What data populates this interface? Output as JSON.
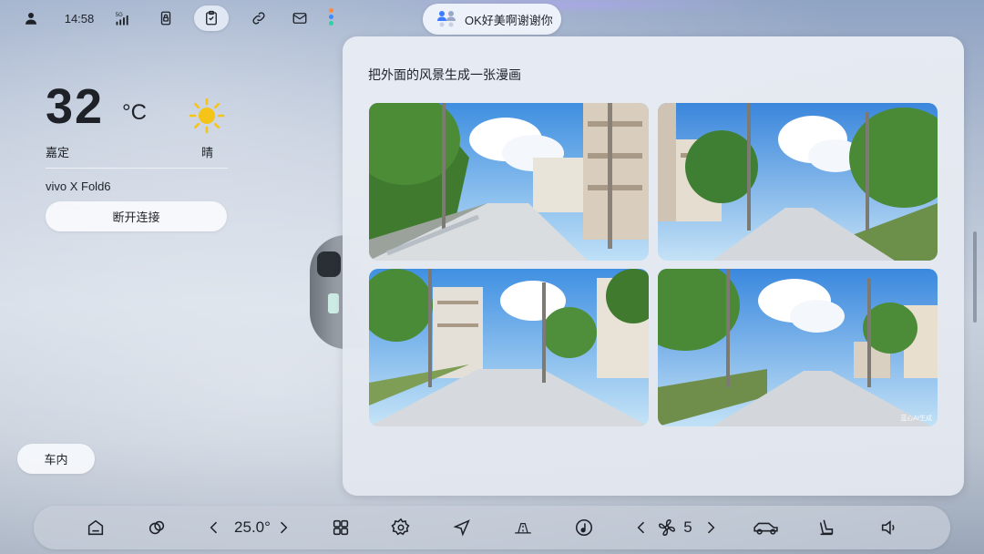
{
  "status_bar": {
    "time": "14:58",
    "signal_label": "5G",
    "icons": [
      "person-icon",
      "signal-icon",
      "phone-lock-icon",
      "clipboard-icon",
      "link-icon",
      "mail-icon"
    ]
  },
  "assistant": {
    "text": "OK好美啊谢谢你",
    "icon": "assistant-icon"
  },
  "weather": {
    "temperature": "32",
    "unit": "°C",
    "city": "嘉定",
    "condition": "晴",
    "icon": "sun-icon"
  },
  "connection": {
    "device_name": "vivo X Fold6",
    "disconnect_label": "断开连接"
  },
  "cabin_button": "车内",
  "panel": {
    "title": "把外面的风景生成一张漫画",
    "images": [
      {
        "name": "generated-image-1"
      },
      {
        "name": "generated-image-2"
      },
      {
        "name": "generated-image-3"
      },
      {
        "name": "generated-image-4",
        "watermark": "蓝心AI生成"
      }
    ]
  },
  "dock": {
    "ac_temperature": "25.0°",
    "fan_speed": "5",
    "items": [
      "home-icon",
      "cloud-icon",
      "apps-grid-icon",
      "settings-icon",
      "navigation-icon",
      "road-icon",
      "music-icon",
      "fan-icon",
      "car-icon",
      "seat-icon",
      "volume-icon"
    ]
  },
  "colors": {
    "sun": "#f5c418",
    "accent_dots": [
      "#ff8a3c",
      "#3a8cff",
      "#2ad4a0"
    ]
  }
}
